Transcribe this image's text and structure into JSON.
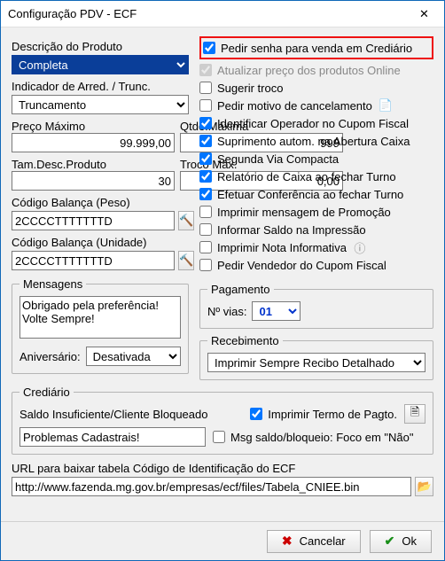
{
  "window": {
    "title": "Configuração PDV - ECF"
  },
  "left": {
    "descricao_label": "Descrição do Produto",
    "descricao_value": "Completa",
    "indicador_label": "Indicador de Arred. / Trunc.",
    "indicador_value": "Truncamento",
    "preco_max_label": "Preço Máximo",
    "preco_max_value": "99.999,00",
    "qtde_max_label": "Qtde.Máxima",
    "qtde_max_value": "999",
    "tam_desc_label": "Tam.Desc.Produto",
    "tam_desc_value": "30",
    "troco_max_label": "Troco Máx.",
    "troco_max_value": "0,00",
    "cod_bal_peso_label": "Código Balança (Peso)",
    "cod_bal_peso_value": "2CCCCTTTTTTTD",
    "cod_bal_unid_label": "Código Balança (Unidade)",
    "cod_bal_unid_value": "2CCCCTTTTTTTD"
  },
  "checks": {
    "pedir_senha": "Pedir senha para venda em Crediário",
    "atualizar_preco": "Atualizar preço dos produtos Online",
    "sugerir_troco": "Sugerir troco",
    "pedir_motivo": "Pedir motivo de cancelamento",
    "identificar_op": "Identificar Operador no Cupom Fiscal",
    "suprimento": "Suprimento autom. na Abertura Caixa",
    "segunda_via": "Segunda Via Compacta",
    "relatorio_caixa": "Relatório de Caixa ao fechar Turno",
    "efetuar_conf": "Efetuar Conferência ao fechar Turno",
    "imprimir_promo": "Imprimir mensagem de Promoção",
    "informar_saldo": "Informar Saldo na Impressão",
    "imprimir_nota": "Imprimir Nota Informativa",
    "pedir_vendedor": "Pedir Vendedor do Cupom Fiscal"
  },
  "mensagens": {
    "legend": "Mensagens",
    "text": "Obrigado pela preferência!\nVolte Sempre!",
    "aniversario_label": "Aniversário:",
    "aniversario_value": "Desativada"
  },
  "pagamento": {
    "legend": "Pagamento",
    "vias_label": "Nº vias:",
    "vias_value": "01"
  },
  "recebimento": {
    "legend": "Recebimento",
    "value": "Imprimir Sempre Recibo Detalhado"
  },
  "crediario": {
    "legend": "Crediário",
    "saldo_label": "Saldo Insuficiente/Cliente Bloqueado",
    "saldo_value": "Problemas Cadastrais!",
    "imprimir_termo": "Imprimir Termo de Pagto.",
    "msg_saldo": "Msg saldo/bloqueio: Foco em \"Não\""
  },
  "url": {
    "label": "URL para baixar tabela Código de Identificação do ECF",
    "value": "http://www.fazenda.mg.gov.br/empresas/ecf/files/Tabela_CNIEE.bin"
  },
  "footer": {
    "cancelar": "Cancelar",
    "ok": "Ok"
  }
}
